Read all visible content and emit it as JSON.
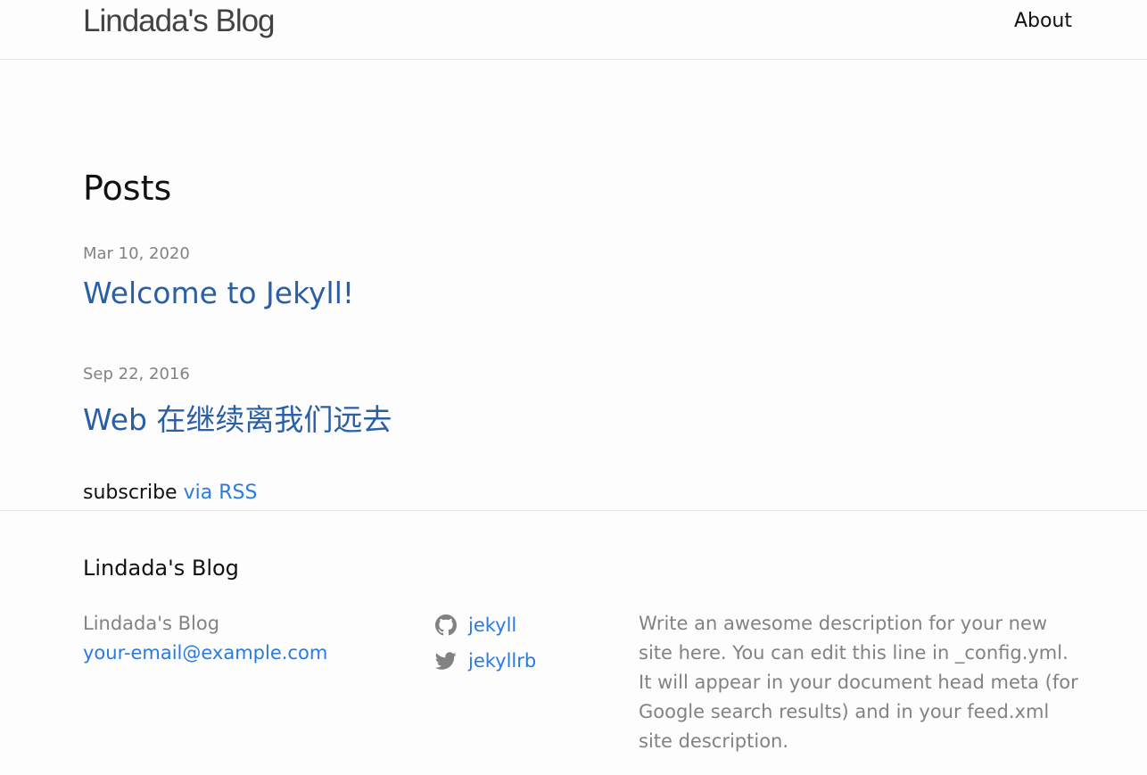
{
  "header": {
    "site_title": "Lindada's Blog",
    "nav": {
      "about": "About"
    }
  },
  "main": {
    "heading": "Posts",
    "posts": [
      {
        "date": "Mar 10, 2020",
        "title": "Welcome to Jekyll!"
      },
      {
        "date": "Sep 22, 2016",
        "title": "Web 在继续离我们远去"
      }
    ],
    "rss": {
      "prefix": "subscribe",
      "link": "via RSS"
    }
  },
  "footer": {
    "heading": "Lindada's Blog",
    "name": "Lindada's Blog",
    "email": "your-email@example.com",
    "social": [
      {
        "icon": "github-icon",
        "label": "jekyll"
      },
      {
        "icon": "twitter-icon",
        "label": "jekyllrb"
      }
    ],
    "description": "Write an awesome description for your new site here. You can edit this line in _config.yml. It will appear in your document head meta (for Google search results) and in your feed.xml site description."
  },
  "colors": {
    "link": "#2a7ae2",
    "post_link": "#2a5ea5",
    "meta_grey": "#828282",
    "border": "#e8e8e8"
  }
}
